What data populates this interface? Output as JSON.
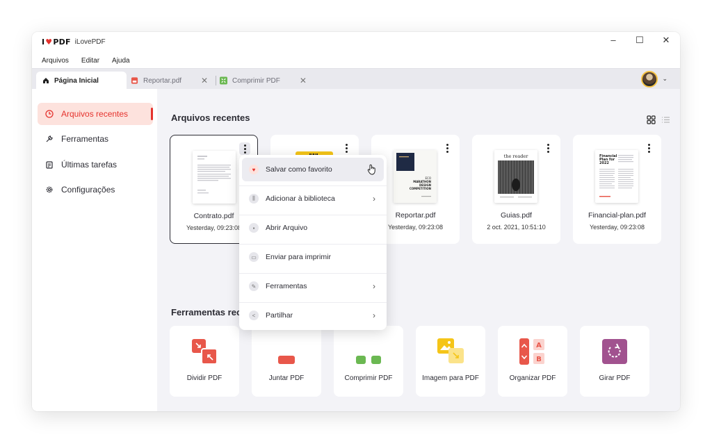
{
  "app": {
    "logo_text": "I♥PDF",
    "title": "iLovePDF",
    "window_controls": [
      "–",
      "☐",
      "✕"
    ]
  },
  "menu": [
    "Arquivos",
    "Editar",
    "Ajuda"
  ],
  "tabs": [
    {
      "label": "Página Inicial",
      "icon": "home-icon"
    },
    {
      "label": "Reportar.pdf",
      "icon": "pdf-file-icon",
      "close": "✕"
    },
    {
      "label": "Comprimir PDF",
      "icon": "compress-icon",
      "close": "✕"
    }
  ],
  "sidebar": {
    "items": [
      {
        "label": "Arquivos recentes",
        "icon": "clock-icon",
        "active": true
      },
      {
        "label": "Ferramentas",
        "icon": "wrench-icon"
      },
      {
        "label": "Últimas tarefas",
        "icon": "clipboard-icon"
      },
      {
        "label": "Configurações",
        "icon": "gear-icon"
      }
    ]
  },
  "recent": {
    "title": "Arquivos recentes",
    "files": [
      {
        "name": "Contrato.pdf",
        "date": "Yesterday, 09:23:08",
        "thumb": "document"
      },
      {
        "name": "",
        "date": "",
        "thumb": "barcode"
      },
      {
        "name": "Reportar.pdf",
        "date": "Yesterday, 09:23:08",
        "thumb": "poster",
        "thumb_text": [
          "ECO",
          "MARATHON",
          "DESIGN",
          "COMPETITION"
        ]
      },
      {
        "name": "Guias.pdf",
        "date": "2 oct. 2021, 10:51:10",
        "thumb": "magazine",
        "thumb_text": [
          "the reader"
        ]
      },
      {
        "name": "Financial-plan.pdf",
        "date": "Yesterday, 09:23:08",
        "thumb": "report",
        "thumb_text": [
          "Financial",
          "Plan for",
          "2022"
        ]
      }
    ]
  },
  "tools": {
    "title": "Ferramentas rece",
    "items": [
      {
        "label": "Dividir PDF",
        "icon": "split-pdf-icon",
        "color": "#e8574a"
      },
      {
        "label": "Juntar PDF",
        "icon": "merge-pdf-icon",
        "color": "#e8574a"
      },
      {
        "label": "Comprimir PDF",
        "icon": "compress-pdf-icon",
        "color": "#6bb852"
      },
      {
        "label": "Imagem para PDF",
        "icon": "image-to-pdf-icon",
        "color": "#f5c518"
      },
      {
        "label": "Organizar PDF",
        "icon": "organize-pdf-icon",
        "color": "#e8574a",
        "letters": [
          "A",
          "B"
        ]
      },
      {
        "label": "Girar PDF",
        "icon": "rotate-pdf-icon",
        "color": "#a1528f"
      }
    ]
  },
  "context_menu": {
    "items": [
      {
        "label": "Salvar como favorito",
        "icon": "heart-icon"
      },
      {
        "label": "Adicionar à biblioteca",
        "icon": "library-icon",
        "submenu": true
      },
      {
        "label": "Abrir Arquivo",
        "icon": "file-icon"
      },
      {
        "label": "Enviar para imprimir",
        "icon": "print-icon"
      },
      {
        "label": "Ferramentas",
        "icon": "wrench-icon",
        "submenu": true
      },
      {
        "label": "Partilhar",
        "icon": "share-icon",
        "submenu": true
      }
    ]
  },
  "colors": {
    "accent": "#e5322d",
    "active_bg": "#fde2dd",
    "main_bg": "#f3f3f7"
  }
}
